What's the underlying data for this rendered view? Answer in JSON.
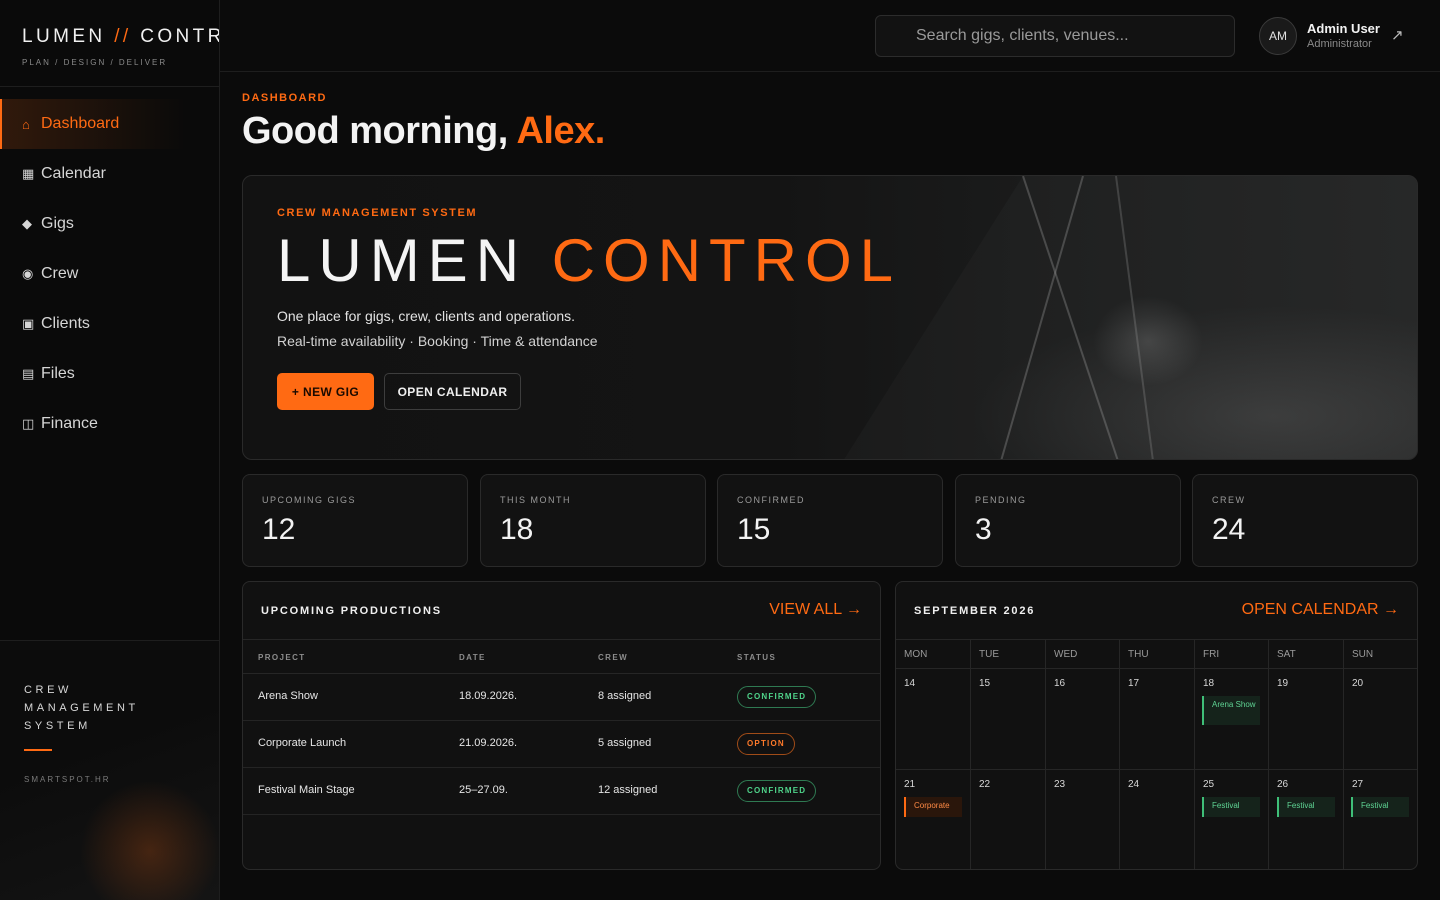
{
  "brand": {
    "name_a": "LUMEN",
    "separator": "//",
    "name_b": "CONTROL",
    "tagline": "PLAN / DESIGN / DELIVER"
  },
  "sidebar": {
    "items": [
      {
        "icon": "⌂",
        "label": "Dashboard",
        "icon_name": "home-icon"
      },
      {
        "icon": "▦",
        "label": "Calendar",
        "icon_name": "calendar-icon"
      },
      {
        "icon": "◆",
        "label": "Gigs",
        "icon_name": "diamond-icon"
      },
      {
        "icon": "◉",
        "label": "Crew",
        "icon_name": "crew-icon"
      },
      {
        "icon": "▣",
        "label": "Clients",
        "icon_name": "clients-icon"
      },
      {
        "icon": "▤",
        "label": "Files",
        "icon_name": "files-icon"
      },
      {
        "icon": "◫",
        "label": "Finance",
        "icon_name": "finance-icon"
      }
    ],
    "footer": {
      "line1": "CREW",
      "line2": "MANAGEMENT",
      "line3": "SYSTEM",
      "site": "SMARTSPOT.HR"
    }
  },
  "topbar": {
    "search_placeholder": "Search gigs, clients, venues...",
    "user": {
      "initials": "AM",
      "name": "Admin User",
      "role": "Administrator",
      "arrow": "↗"
    }
  },
  "page": {
    "breadcrumb": "DASHBOARD",
    "greeting": "Good morning,",
    "greeting_name": "Alex."
  },
  "hero": {
    "kicker": "CREW MANAGEMENT SYSTEM",
    "title_a": "LUMEN",
    "title_b": "CONTROL",
    "line1": "One place for gigs, crew, clients and operations.",
    "line2": "Real-time availability · Booking · Time & attendance",
    "primary_label": "+ NEW GIG",
    "secondary_label": "OPEN CALENDAR"
  },
  "stats": [
    {
      "label": "UPCOMING GIGS",
      "value": "12"
    },
    {
      "label": "THIS MONTH",
      "value": "18"
    },
    {
      "label": "CONFIRMED",
      "value": "15"
    },
    {
      "label": "PENDING",
      "value": "3"
    },
    {
      "label": "CREW",
      "value": "24"
    }
  ],
  "productions": {
    "title": "UPCOMING PRODUCTIONS",
    "link": "VIEW ALL →",
    "columns": [
      "PROJECT",
      "DATE",
      "CREW",
      "STATUS"
    ],
    "rows": [
      {
        "project": "Arena Show",
        "date": "18.09.2026.",
        "crew": "8 assigned",
        "status": "CONFIRMED"
      },
      {
        "project": "Corporate Launch",
        "date": "21.09.2026.",
        "crew": "5 assigned",
        "status": "OPTION"
      },
      {
        "project": "Festival Main Stage",
        "date": "25–27.09.",
        "crew": "12 assigned",
        "status": "CONFIRMED"
      }
    ]
  },
  "calendar": {
    "title": "SEPTEMBER 2026",
    "link": "OPEN CALENDAR →",
    "weekdays": [
      "MON",
      "TUE",
      "WED",
      "THU",
      "FRI",
      "SAT",
      "SUN"
    ],
    "week1": [
      "14",
      "15",
      "16",
      "17",
      "18",
      "19",
      "20"
    ],
    "week2": [
      "21",
      "22",
      "23",
      "24",
      "25",
      "26",
      "27"
    ],
    "events": {
      "arena": "Arena Show",
      "corporate": "Corporate",
      "festival": "Festival"
    }
  },
  "colors": {
    "accent": "#ff6a13",
    "confirmed": "#4fd38a",
    "background": "#0b0b0b"
  }
}
